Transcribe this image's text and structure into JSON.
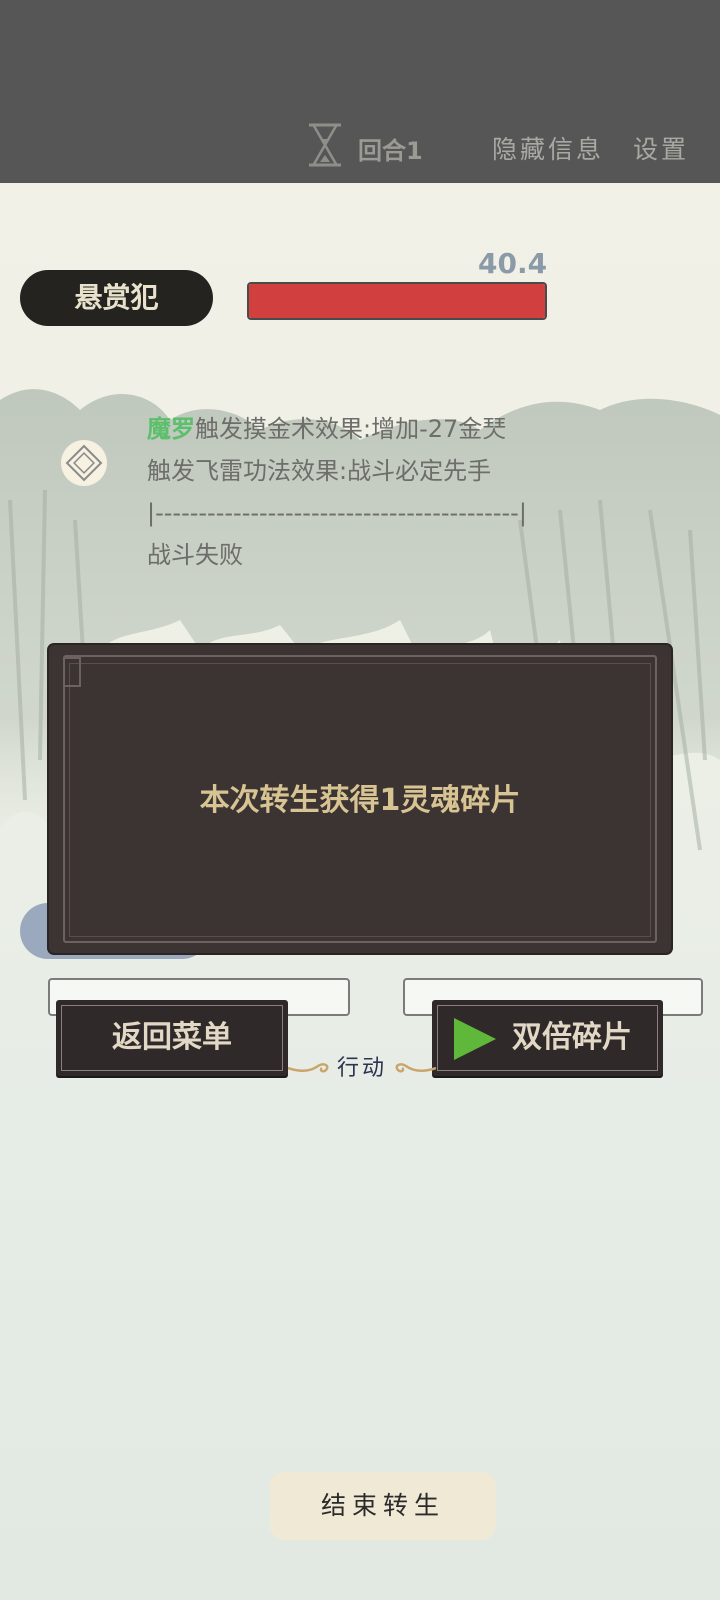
{
  "topbar": {
    "round_label": "回合1",
    "hide_info_label": "隐藏信息",
    "settings_label": "设置"
  },
  "enemy": {
    "name_label": "悬赏犯",
    "hp_value": "40.4",
    "hp_fraction": 1.0
  },
  "battle_log": {
    "line1_name": "魔罗",
    "line1_text": "触发摸金术效果:增加-27金珡",
    "line2_text": "触发飞雷功法效果:战斗必定先手",
    "separator": "|------------------------------------------|",
    "line4_text": "战斗失败"
  },
  "dialog": {
    "message": "本次转生获得1灵魂碎片"
  },
  "actions": {
    "back_label": "返回菜单",
    "double_label": "双倍碎片",
    "action_caption": "行动"
  },
  "footer": {
    "end_label": "结束转生"
  },
  "colors": {
    "topbar": "#565656",
    "hp_bar": "#d23f3f",
    "name_highlight": "#5bbf6b",
    "dialog_bg": "#3c3433",
    "dialog_text": "#d8c493",
    "play_icon": "#5fb83a"
  }
}
